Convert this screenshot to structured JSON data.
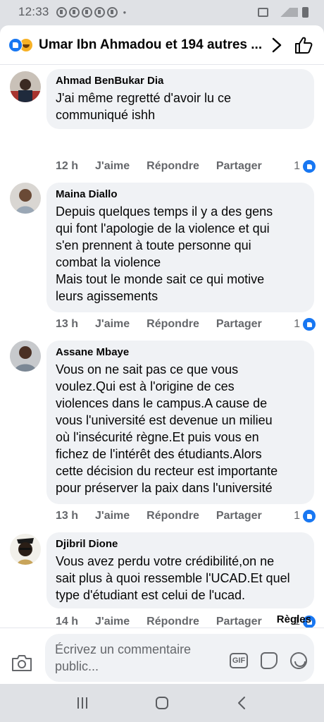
{
  "status": {
    "time": "12:33",
    "notification_icons": [
      "notification-icon",
      "notification-icon",
      "notification-icon",
      "notification-icon",
      "notification-icon"
    ],
    "indicators": [
      "alarm-icon",
      "wifi-icon",
      "signal-icon",
      "battery-icon"
    ]
  },
  "header": {
    "title": "Umar Ibn Ahmadou et 194 autres ...",
    "reaction_icons": [
      "like-reaction-icon",
      "haha-reaction-icon"
    ],
    "colors": {
      "like": "#1877f2",
      "haha": "#f7b125"
    }
  },
  "comments": [
    {
      "author": "Ahmad BenBukar Dia",
      "text": "J'ai même regretté d'avoir lu ce\ncommuniqué ishh",
      "time": "12 h",
      "like": "J'aime",
      "reply": "Répondre",
      "share": "Partager",
      "likes": "1"
    },
    {
      "author": "Maina Diallo",
      "text": "Depuis quelques temps il y a des gens\nqui font l'apologie de la violence et qui\ns'en prennent à toute personne qui\ncombat la violence\nMais tout le monde sait ce qui motive\nleurs agissements",
      "time": "13 h",
      "like": "J'aime",
      "reply": "Répondre",
      "share": "Partager",
      "likes": "1"
    },
    {
      "author": "Assane Mbaye",
      "text": "Vous on ne sait pas ce que vous\nvoulez.Qui est à l'origine de ces\nviolences dans le campus.A cause de\nvous l'université est devenue un milieu\noù l'insécurité règne.Et puis vous en\nfichez de l'intérêt des étudiants.Alors\ncette décision du recteur est importante\npour préserver la paix dans l'université",
      "time": "13 h",
      "like": "J'aime",
      "reply": "Répondre",
      "share": "Partager",
      "likes": "1"
    },
    {
      "author": "Djibril Dione",
      "text": "Vous avez perdu votre crédibilité,on ne\nsait plus à quoi ressemble l'UCAD.Et quel\ntype d'étudiant  est celui de l'ucad.",
      "time": "14 h",
      "like": "J'aime",
      "reply": "Répondre",
      "share": "Partager",
      "likes": "1"
    }
  ],
  "sort_label": "Règles",
  "composer": {
    "placeholder": "Écrivez un commentaire\npublic...",
    "gif_label": "GIF"
  }
}
